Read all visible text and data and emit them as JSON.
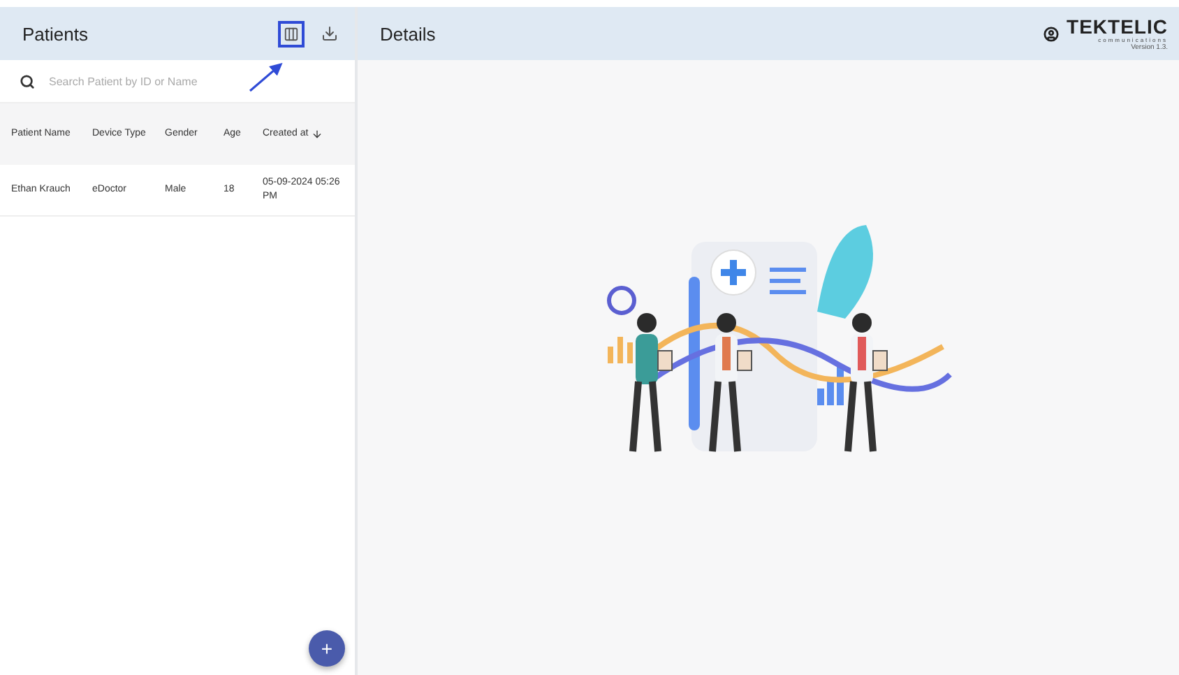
{
  "patients_panel": {
    "title": "Patients",
    "search": {
      "placeholder": "Search Patient by ID or Name"
    },
    "columns": [
      {
        "label": "Patient Name",
        "sorted": false
      },
      {
        "label": "Device Type",
        "sorted": false
      },
      {
        "label": "Gender",
        "sorted": false
      },
      {
        "label": "Age",
        "sorted": false
      },
      {
        "label": "Created at",
        "sorted": true
      }
    ],
    "rows": [
      {
        "cells": [
          "Ethan Krauch",
          "eDoctor",
          "Male",
          "18",
          "05-09-2024 05:26 PM"
        ]
      }
    ],
    "add_button": {
      "label": "+"
    }
  },
  "annotation": {
    "highlighted": true
  },
  "details_panel": {
    "title": "Details",
    "logo": {
      "name": "TEKTELIC",
      "tagline": "communications"
    },
    "version": "Version 1.3."
  }
}
